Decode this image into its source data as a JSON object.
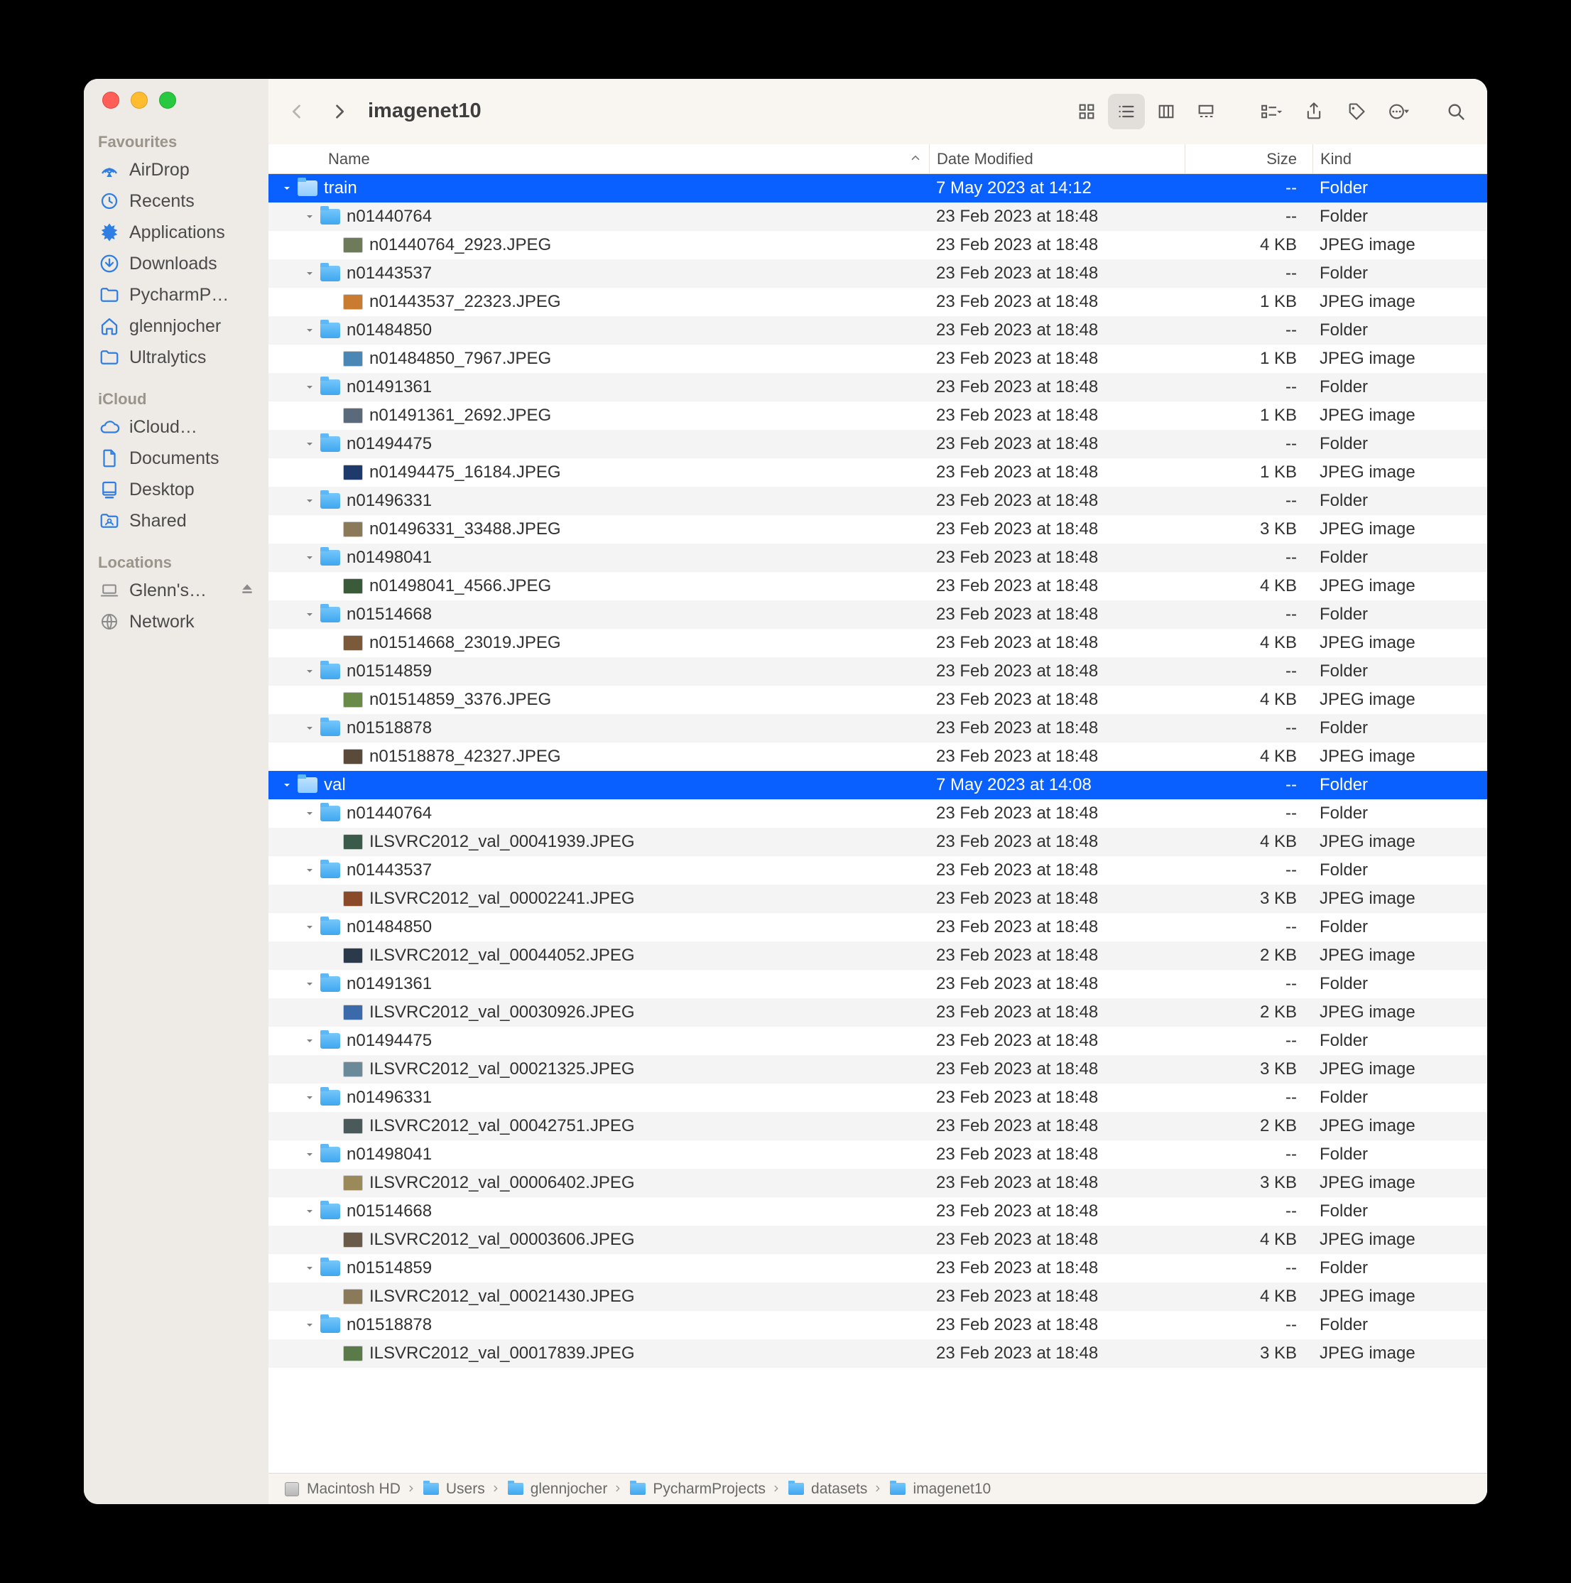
{
  "window_title": "imagenet10",
  "traffic": {
    "close": "close",
    "minimize": "minimize",
    "zoom": "zoom"
  },
  "sidebar": {
    "sections": [
      {
        "label": "Favourites",
        "items": [
          {
            "icon": "airdrop",
            "label": "AirDrop"
          },
          {
            "icon": "recent",
            "label": "Recents"
          },
          {
            "icon": "apps",
            "label": "Applications"
          },
          {
            "icon": "download",
            "label": "Downloads"
          },
          {
            "icon": "folder",
            "label": "PycharmP…"
          },
          {
            "icon": "home",
            "label": "glennjocher"
          },
          {
            "icon": "folder",
            "label": "Ultralytics"
          }
        ]
      },
      {
        "label": "iCloud",
        "items": [
          {
            "icon": "cloud",
            "label": "iCloud…"
          },
          {
            "icon": "doc",
            "label": "Documents"
          },
          {
            "icon": "desktop",
            "label": "Desktop"
          },
          {
            "icon": "shared",
            "label": "Shared"
          }
        ]
      },
      {
        "label": "Locations",
        "items": [
          {
            "icon": "laptop",
            "label": "Glenn's…",
            "eject": true,
            "grey": true
          },
          {
            "icon": "network",
            "label": "Network",
            "grey": true
          }
        ]
      }
    ]
  },
  "columns": {
    "name": "Name",
    "date": "Date Modified",
    "size": "Size",
    "kind": "Kind"
  },
  "rows": [
    {
      "depth": 0,
      "expanded": true,
      "type": "folder",
      "name": "train",
      "date": "7 May 2023 at 14:12",
      "size": "--",
      "kind": "Folder",
      "selected": true
    },
    {
      "depth": 1,
      "expanded": true,
      "type": "folder",
      "name": "n01440764",
      "date": "23 Feb 2023 at 18:48",
      "size": "--",
      "kind": "Folder"
    },
    {
      "depth": 2,
      "type": "jpeg",
      "name": "n01440764_2923.JPEG",
      "date": "23 Feb 2023 at 18:48",
      "size": "4 KB",
      "kind": "JPEG image",
      "thumb": "#6d7b5a"
    },
    {
      "depth": 1,
      "expanded": true,
      "type": "folder",
      "name": "n01443537",
      "date": "23 Feb 2023 at 18:48",
      "size": "--",
      "kind": "Folder"
    },
    {
      "depth": 2,
      "type": "jpeg",
      "name": "n01443537_22323.JPEG",
      "date": "23 Feb 2023 at 18:48",
      "size": "1 KB",
      "kind": "JPEG image",
      "thumb": "#c97b2f"
    },
    {
      "depth": 1,
      "expanded": true,
      "type": "folder",
      "name": "n01484850",
      "date": "23 Feb 2023 at 18:48",
      "size": "--",
      "kind": "Folder"
    },
    {
      "depth": 2,
      "type": "jpeg",
      "name": "n01484850_7967.JPEG",
      "date": "23 Feb 2023 at 18:48",
      "size": "1 KB",
      "kind": "JPEG image",
      "thumb": "#4a87b5"
    },
    {
      "depth": 1,
      "expanded": true,
      "type": "folder",
      "name": "n01491361",
      "date": "23 Feb 2023 at 18:48",
      "size": "--",
      "kind": "Folder"
    },
    {
      "depth": 2,
      "type": "jpeg",
      "name": "n01491361_2692.JPEG",
      "date": "23 Feb 2023 at 18:48",
      "size": "1 KB",
      "kind": "JPEG image",
      "thumb": "#5a6a7a"
    },
    {
      "depth": 1,
      "expanded": true,
      "type": "folder",
      "name": "n01494475",
      "date": "23 Feb 2023 at 18:48",
      "size": "--",
      "kind": "Folder"
    },
    {
      "depth": 2,
      "type": "jpeg",
      "name": "n01494475_16184.JPEG",
      "date": "23 Feb 2023 at 18:48",
      "size": "1 KB",
      "kind": "JPEG image",
      "thumb": "#1e3a6a"
    },
    {
      "depth": 1,
      "expanded": true,
      "type": "folder",
      "name": "n01496331",
      "date": "23 Feb 2023 at 18:48",
      "size": "--",
      "kind": "Folder"
    },
    {
      "depth": 2,
      "type": "jpeg",
      "name": "n01496331_33488.JPEG",
      "date": "23 Feb 2023 at 18:48",
      "size": "3 KB",
      "kind": "JPEG image",
      "thumb": "#8a7a5a"
    },
    {
      "depth": 1,
      "expanded": true,
      "type": "folder",
      "name": "n01498041",
      "date": "23 Feb 2023 at 18:48",
      "size": "--",
      "kind": "Folder"
    },
    {
      "depth": 2,
      "type": "jpeg",
      "name": "n01498041_4566.JPEG",
      "date": "23 Feb 2023 at 18:48",
      "size": "4 KB",
      "kind": "JPEG image",
      "thumb": "#3a5a3a"
    },
    {
      "depth": 1,
      "expanded": true,
      "type": "folder",
      "name": "n01514668",
      "date": "23 Feb 2023 at 18:48",
      "size": "--",
      "kind": "Folder"
    },
    {
      "depth": 2,
      "type": "jpeg",
      "name": "n01514668_23019.JPEG",
      "date": "23 Feb 2023 at 18:48",
      "size": "4 KB",
      "kind": "JPEG image",
      "thumb": "#7a5a3a"
    },
    {
      "depth": 1,
      "expanded": true,
      "type": "folder",
      "name": "n01514859",
      "date": "23 Feb 2023 at 18:48",
      "size": "--",
      "kind": "Folder"
    },
    {
      "depth": 2,
      "type": "jpeg",
      "name": "n01514859_3376.JPEG",
      "date": "23 Feb 2023 at 18:48",
      "size": "4 KB",
      "kind": "JPEG image",
      "thumb": "#6a8a4a"
    },
    {
      "depth": 1,
      "expanded": true,
      "type": "folder",
      "name": "n01518878",
      "date": "23 Feb 2023 at 18:48",
      "size": "--",
      "kind": "Folder"
    },
    {
      "depth": 2,
      "type": "jpeg",
      "name": "n01518878_42327.JPEG",
      "date": "23 Feb 2023 at 18:48",
      "size": "4 KB",
      "kind": "JPEG image",
      "thumb": "#5a4a3a"
    },
    {
      "depth": 0,
      "expanded": true,
      "type": "folder",
      "name": "val",
      "date": "7 May 2023 at 14:08",
      "size": "--",
      "kind": "Folder",
      "selected": true
    },
    {
      "depth": 1,
      "expanded": true,
      "type": "folder",
      "name": "n01440764",
      "date": "23 Feb 2023 at 18:48",
      "size": "--",
      "kind": "Folder"
    },
    {
      "depth": 2,
      "type": "jpeg",
      "name": "ILSVRC2012_val_00041939.JPEG",
      "date": "23 Feb 2023 at 18:48",
      "size": "4 KB",
      "kind": "JPEG image",
      "thumb": "#3a5a4a"
    },
    {
      "depth": 1,
      "expanded": true,
      "type": "folder",
      "name": "n01443537",
      "date": "23 Feb 2023 at 18:48",
      "size": "--",
      "kind": "Folder"
    },
    {
      "depth": 2,
      "type": "jpeg",
      "name": "ILSVRC2012_val_00002241.JPEG",
      "date": "23 Feb 2023 at 18:48",
      "size": "3 KB",
      "kind": "JPEG image",
      "thumb": "#8a4a2a"
    },
    {
      "depth": 1,
      "expanded": true,
      "type": "folder",
      "name": "n01484850",
      "date": "23 Feb 2023 at 18:48",
      "size": "--",
      "kind": "Folder"
    },
    {
      "depth": 2,
      "type": "jpeg",
      "name": "ILSVRC2012_val_00044052.JPEG",
      "date": "23 Feb 2023 at 18:48",
      "size": "2 KB",
      "kind": "JPEG image",
      "thumb": "#2a3a4a"
    },
    {
      "depth": 1,
      "expanded": true,
      "type": "folder",
      "name": "n01491361",
      "date": "23 Feb 2023 at 18:48",
      "size": "--",
      "kind": "Folder"
    },
    {
      "depth": 2,
      "type": "jpeg",
      "name": "ILSVRC2012_val_00030926.JPEG",
      "date": "23 Feb 2023 at 18:48",
      "size": "2 KB",
      "kind": "JPEG image",
      "thumb": "#3a6aaa"
    },
    {
      "depth": 1,
      "expanded": true,
      "type": "folder",
      "name": "n01494475",
      "date": "23 Feb 2023 at 18:48",
      "size": "--",
      "kind": "Folder"
    },
    {
      "depth": 2,
      "type": "jpeg",
      "name": "ILSVRC2012_val_00021325.JPEG",
      "date": "23 Feb 2023 at 18:48",
      "size": "3 KB",
      "kind": "JPEG image",
      "thumb": "#6a8a9a"
    },
    {
      "depth": 1,
      "expanded": true,
      "type": "folder",
      "name": "n01496331",
      "date": "23 Feb 2023 at 18:48",
      "size": "--",
      "kind": "Folder"
    },
    {
      "depth": 2,
      "type": "jpeg",
      "name": "ILSVRC2012_val_00042751.JPEG",
      "date": "23 Feb 2023 at 18:48",
      "size": "2 KB",
      "kind": "JPEG image",
      "thumb": "#4a5a5a"
    },
    {
      "depth": 1,
      "expanded": true,
      "type": "folder",
      "name": "n01498041",
      "date": "23 Feb 2023 at 18:48",
      "size": "--",
      "kind": "Folder"
    },
    {
      "depth": 2,
      "type": "jpeg",
      "name": "ILSVRC2012_val_00006402.JPEG",
      "date": "23 Feb 2023 at 18:48",
      "size": "3 KB",
      "kind": "JPEG image",
      "thumb": "#9a8a5a"
    },
    {
      "depth": 1,
      "expanded": true,
      "type": "folder",
      "name": "n01514668",
      "date": "23 Feb 2023 at 18:48",
      "size": "--",
      "kind": "Folder"
    },
    {
      "depth": 2,
      "type": "jpeg",
      "name": "ILSVRC2012_val_00003606.JPEG",
      "date": "23 Feb 2023 at 18:48",
      "size": "4 KB",
      "kind": "JPEG image",
      "thumb": "#6a5a4a"
    },
    {
      "depth": 1,
      "expanded": true,
      "type": "folder",
      "name": "n01514859",
      "date": "23 Feb 2023 at 18:48",
      "size": "--",
      "kind": "Folder"
    },
    {
      "depth": 2,
      "type": "jpeg",
      "name": "ILSVRC2012_val_00021430.JPEG",
      "date": "23 Feb 2023 at 18:48",
      "size": "4 KB",
      "kind": "JPEG image",
      "thumb": "#8a7a5a"
    },
    {
      "depth": 1,
      "expanded": true,
      "type": "folder",
      "name": "n01518878",
      "date": "23 Feb 2023 at 18:48",
      "size": "--",
      "kind": "Folder"
    },
    {
      "depth": 2,
      "type": "jpeg",
      "name": "ILSVRC2012_val_00017839.JPEG",
      "date": "23 Feb 2023 at 18:48",
      "size": "3 KB",
      "kind": "JPEG image",
      "thumb": "#5a7a4a"
    }
  ],
  "path": [
    {
      "icon": "hd",
      "label": "Macintosh HD"
    },
    {
      "icon": "folder",
      "label": "Users"
    },
    {
      "icon": "folder",
      "label": "glennjocher"
    },
    {
      "icon": "folder",
      "label": "PycharmProjects"
    },
    {
      "icon": "folder",
      "label": "datasets"
    },
    {
      "icon": "folder",
      "label": "imagenet10"
    }
  ]
}
